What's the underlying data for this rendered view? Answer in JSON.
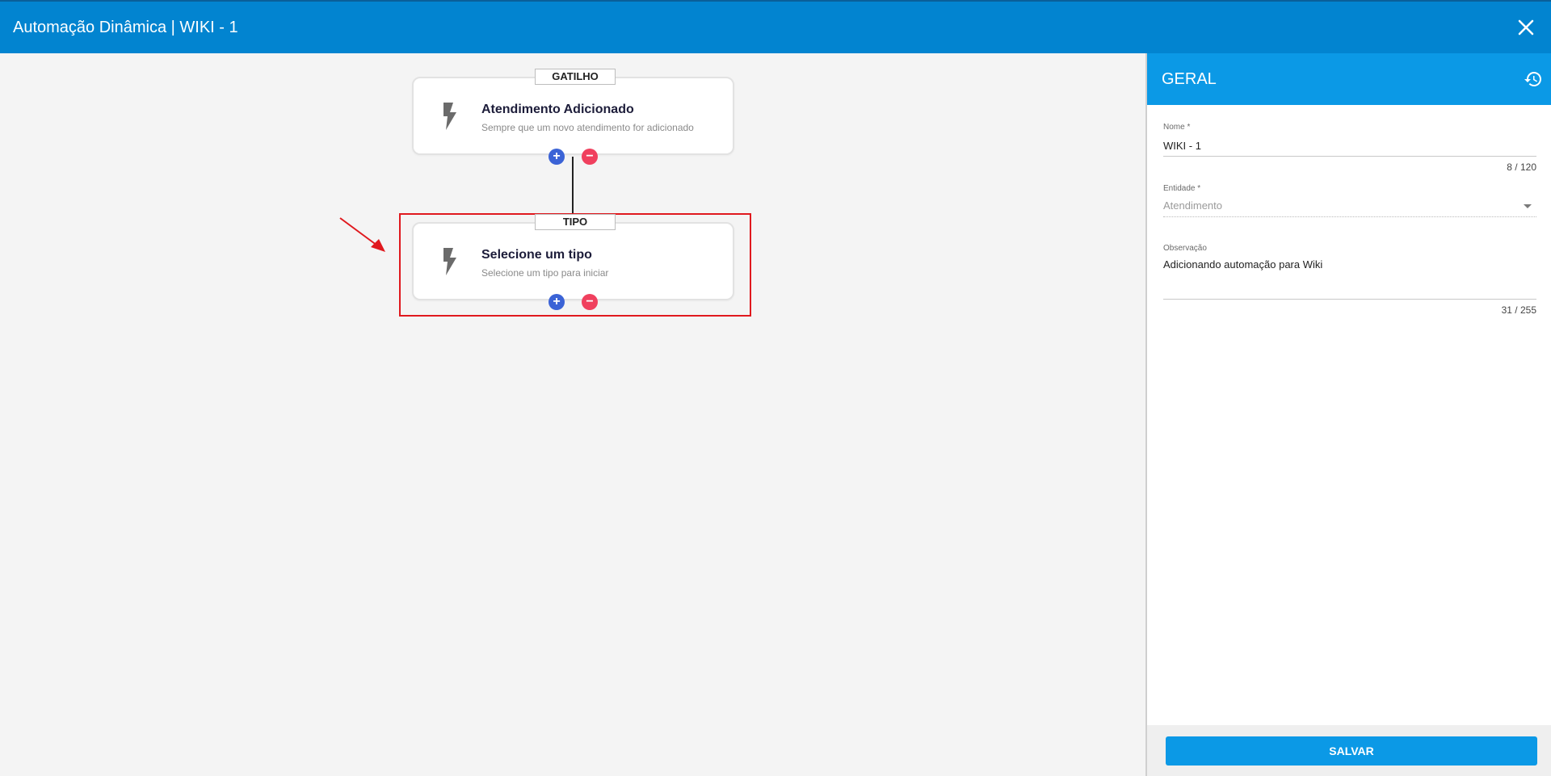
{
  "window": {
    "title": "Automação Dinâmica | WIKI - 1",
    "close_icon": "close-icon"
  },
  "flow": {
    "trigger": {
      "tag": "GATILHO",
      "title": "Atendimento Adicionado",
      "subtitle": "Sempre que um novo atendimento for adicionado",
      "icon": "lightning-bolt-icon"
    },
    "type": {
      "tag": "TIPO",
      "title": "Selecione um tipo",
      "subtitle": "Selecione um tipo para iniciar",
      "icon": "lightning-bolt-icon"
    },
    "add_symbol": "+",
    "remove_symbol": "−",
    "highlight_color": "#e0191e"
  },
  "panel": {
    "title": "GERAL",
    "history_icon": "history-icon",
    "nome": {
      "label": "Nome *",
      "value": "WIKI - 1",
      "counter": "8 / 120"
    },
    "entidade": {
      "label": "Entidade *",
      "value": "Atendimento"
    },
    "observacao": {
      "label": "Observação",
      "value": "Adicionando automação para Wiki",
      "counter": "31 / 255"
    },
    "save_label": "SALVAR"
  },
  "colors": {
    "header": "#0284d0",
    "panel_header": "#0b99e6",
    "add": "#3b63d6",
    "remove": "#f0405e"
  }
}
